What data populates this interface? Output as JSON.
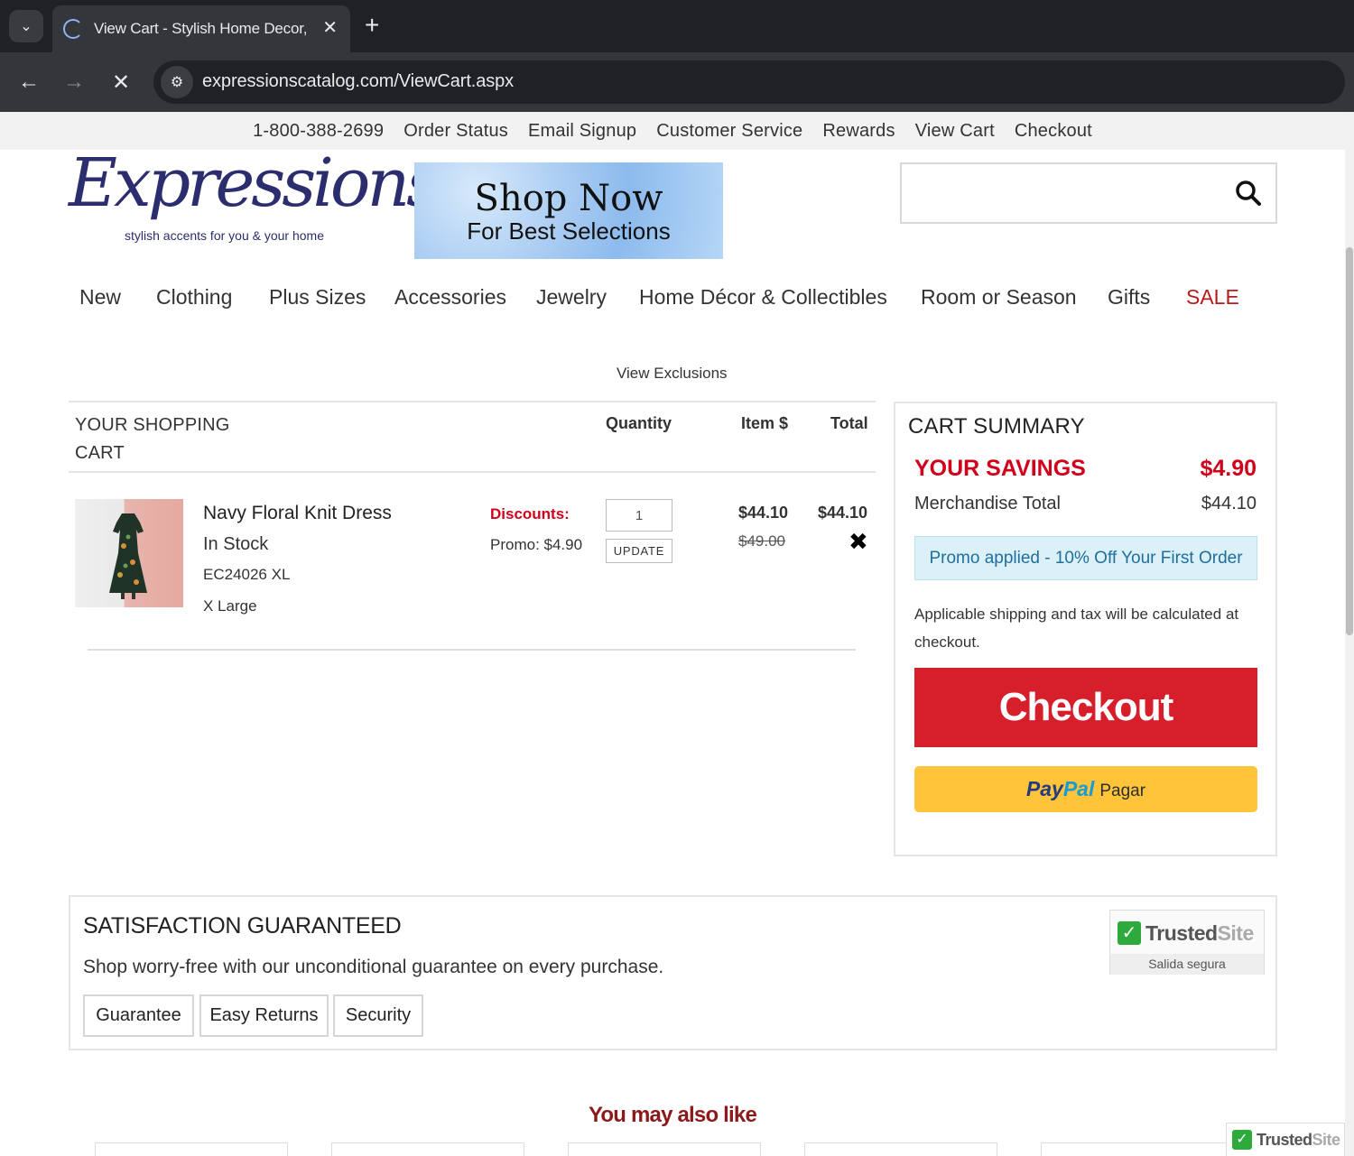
{
  "browser": {
    "tab_title": "View Cart - Stylish Home Decor,",
    "url": "expressionscatalog.com/ViewCart.aspx"
  },
  "utility_nav": [
    "1-800-388-2699",
    "Order Status",
    "Email Signup",
    "Customer Service",
    "Rewards",
    "View Cart",
    "Checkout"
  ],
  "logo": {
    "word": "Expressions",
    "tagline": "stylish accents for you & your home"
  },
  "banner": {
    "headline": "Shop Now",
    "subline": "For Best Selections"
  },
  "search": {
    "placeholder": "",
    "icon": "search-icon"
  },
  "main_nav": [
    "New",
    "Clothing",
    "Plus Sizes",
    "Accessories",
    "Jewelry",
    "Home Décor & Collectibles",
    "Room or Season",
    "Gifts",
    "SALE"
  ],
  "exclusions_link": "View Exclusions",
  "cart": {
    "heading_line1": "YOUR SHOPPING",
    "heading_line2": "CART",
    "col_quantity": "Quantity",
    "col_item_price": "Item $",
    "col_total": "Total",
    "item": {
      "name": "Navy Floral Knit Dress",
      "stock": "In Stock",
      "sku": "EC24026 XL",
      "size": "X Large",
      "discounts_label": "Discounts:",
      "promo": "Promo: $4.90",
      "quantity": "1",
      "update_label": "UPDATE",
      "price": "$44.10",
      "original_price": "$49.00",
      "total": "$44.10",
      "remove_icon": "close-icon"
    }
  },
  "summary": {
    "title": "CART SUMMARY",
    "savings_label": "YOUR SAVINGS",
    "savings_value": "$4.90",
    "merch_label": "Merchandise Total",
    "merch_value": "$44.10",
    "promo_applied": "Promo applied - 10% Off Your First Order",
    "shipping_note": "Applicable shipping and tax will be calculated at checkout.",
    "checkout_label": "Checkout",
    "paypal_pay": "Pay",
    "paypal_pal": "Pal",
    "paypal_action": "Pagar"
  },
  "satisfaction": {
    "title": "SATISFACTION GUARANTEED",
    "text": "Shop worry-free with our unconditional guarantee on every purchase.",
    "buttons": [
      "Guarantee",
      "Easy Returns",
      "Security"
    ],
    "trusted_word1": "Trusted",
    "trusted_word2": "Site",
    "trusted_sub": "Salida segura"
  },
  "recommendations_title": "You may also like",
  "colors": {
    "brand_navy": "#2b2d6e",
    "sale_red": "#b71c1c",
    "checkout_red": "#d71f2c",
    "paypal_yellow": "#ffc439",
    "promo_blue": "#dcf0f7"
  }
}
